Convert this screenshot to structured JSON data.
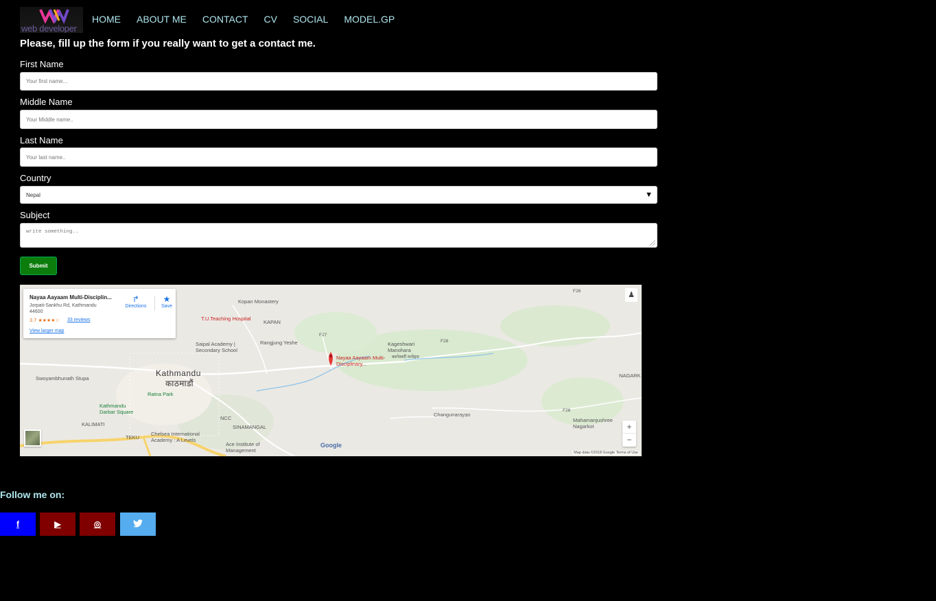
{
  "header": {
    "logo_text": "web developer",
    "nav": [
      "HOME",
      "ABOUT ME",
      "CONTACT",
      "CV",
      "SOCIAL",
      "MODEL.GP"
    ]
  },
  "form": {
    "heading": "Please, fill up the form if you really want to get a contact me.",
    "first_name": {
      "label": "First Name",
      "placeholder": "Your first name..."
    },
    "middle_name": {
      "label": "Middle Name",
      "placeholder": "Your Middle name.."
    },
    "last_name": {
      "label": "Last Name",
      "placeholder": "Your last name.."
    },
    "country": {
      "label": "Country",
      "selected": "Nepal"
    },
    "subject": {
      "label": "Subject",
      "placeholder": "write something.."
    },
    "submit_label": "Submit"
  },
  "map": {
    "place_title": "Nayaa Aayaam Multi-Disciplin...",
    "address": "Jorpati-Sankhu Rd, Kathmandu 44600",
    "rating": "3.7",
    "stars": "★★★★☆",
    "reviews": "33 reviews",
    "larger_map": "View larger map",
    "directions": "Directions",
    "save": "Save",
    "labels": {
      "kopan": "Kopan Monastery",
      "teaching": "T.U.Teaching Hospital",
      "kapan": "KAPAN",
      "saipal": "Saipal Academy | Secondary School",
      "rangjung": "Rangjung Yeshe",
      "kageshwari": "Kageshwari Manohara",
      "kageshwari_np": "कागेश्वरी मनोहरा",
      "marker": "Nayaa Aayaam Multi-Disciplinary...",
      "swoyambhu": "Swoyambhunath Stupa",
      "kathmandu": "Kathmandu",
      "kathmandu_np": "काठमाडौं",
      "ratna": "Ratna Park",
      "durbar": "Kathmandu Darbar Square",
      "ncc": "NCC",
      "kalimati": "KALIMATI",
      "sinamangal": "SINAMANGAL",
      "teku": "TEKU",
      "chelsea": "Chelsea International Academy : A Levels",
      "ace": "Ace Institute of Management",
      "changunarayan": "Changunarayan",
      "mahamanjushree": "Mahamanjushree Nagarkot",
      "nagark": "NAGARK",
      "f26": "F26",
      "f27": "F27",
      "f28": "F28",
      "f26b": "F26"
    },
    "google": "Google",
    "map_data": "Map data ©2018 Google   Terms of Use",
    "zoom_in": "+",
    "zoom_out": "−"
  },
  "social": {
    "heading": "Follow me on:",
    "buttons": [
      {
        "name": "facebook",
        "icon": "f",
        "color": "#0000ff"
      },
      {
        "name": "youtube",
        "icon": "▶",
        "color": "#800000"
      },
      {
        "name": "instagram",
        "icon": "◎",
        "color": "#800000"
      },
      {
        "name": "twitter",
        "icon": "🐦",
        "color": "#55acee"
      }
    ]
  }
}
